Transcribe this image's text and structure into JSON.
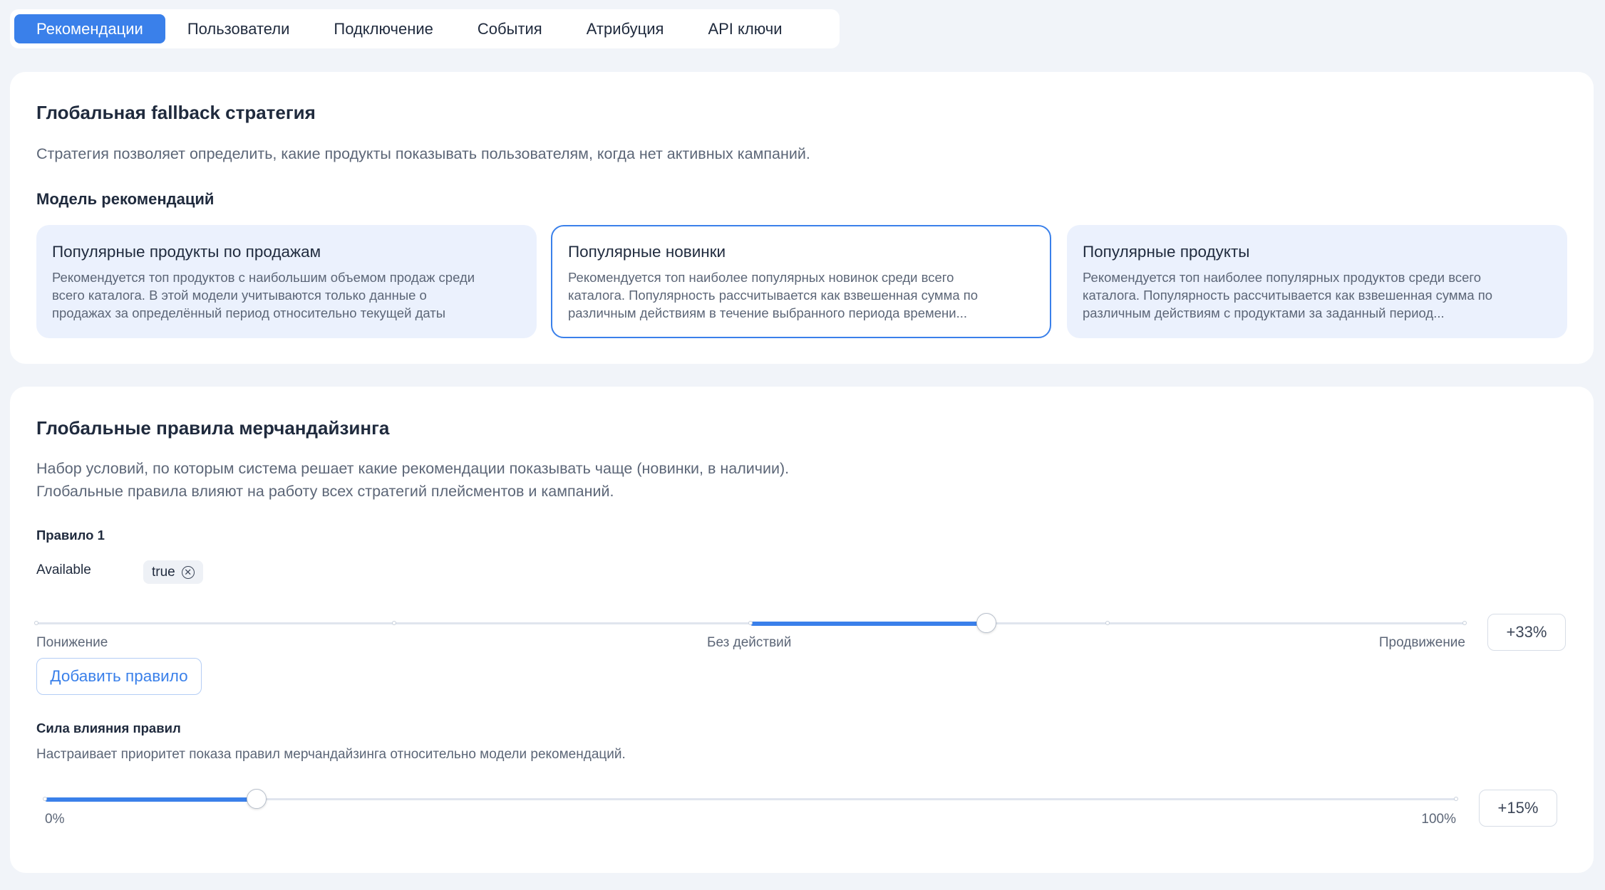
{
  "tabs": [
    {
      "label": "Рекомендации",
      "active": true
    },
    {
      "label": "Пользователи",
      "active": false
    },
    {
      "label": "Подключение",
      "active": false
    },
    {
      "label": "События",
      "active": false
    },
    {
      "label": "Атрибуция",
      "active": false
    },
    {
      "label": "API ключи",
      "active": false
    }
  ],
  "fallback": {
    "title": "Глобальная fallback стратегия",
    "description": "Стратегия позволяет определить, какие продукты показывать пользователям, когда нет активных кампаний.",
    "model_label": "Модель рекомендаций",
    "models": [
      {
        "title": "Популярные продукты по продажам",
        "desc1": "Рекомендуется топ продуктов с наибольшим объемом продаж среди",
        "desc2": "всего каталога. В этой модели учитываются только данные о",
        "desc3": "продажах за определённый период относительно текущей даты",
        "selected": false
      },
      {
        "title": "Популярные новинки",
        "desc1": "Рекомендуется топ наиболее популярных новинок среди всего",
        "desc2": "каталога. Популярность рассчитывается как взвешенная сумма по",
        "desc3": "различным действиям в течение выбранного периода времени...",
        "selected": true
      },
      {
        "title": "Популярные продукты",
        "desc1": "Рекомендуется топ наиболее популярных продуктов среди всего",
        "desc2": "каталога. Популярность рассчитывается как взвешенная сумма по",
        "desc3": "различным действиям с продуктами за заданный период...",
        "selected": false
      }
    ]
  },
  "merch": {
    "title": "Глобальные правила мерчандайзинга",
    "desc1": "Набор условий, по которым система решает какие рекомендации показывать чаще (новинки, в наличии).",
    "desc2": "Глобальные правила влияют на работу всех стратегий плейсментов и кампаний.",
    "rule": {
      "label": "Правило 1",
      "attribute": "Available",
      "chip_value": "true",
      "slider_value_percent": 33,
      "value_text": "+33%",
      "label_min": "Понижение",
      "label_mid": "Без действий",
      "label_max": "Продвижение"
    },
    "add_rule_label": "Добавить правило",
    "strength": {
      "title": "Сила влияния правил",
      "description": "Настраивает приоритет показа правил мерчандайзинга относительно модели рекомендаций.",
      "value_percent": 15,
      "value_text": "+15%",
      "label_min": "0%",
      "label_max": "100%"
    }
  },
  "colors": {
    "accent": "#3a80ea",
    "background": "#f1f4f9",
    "card_inactive": "#ebf1fd"
  }
}
